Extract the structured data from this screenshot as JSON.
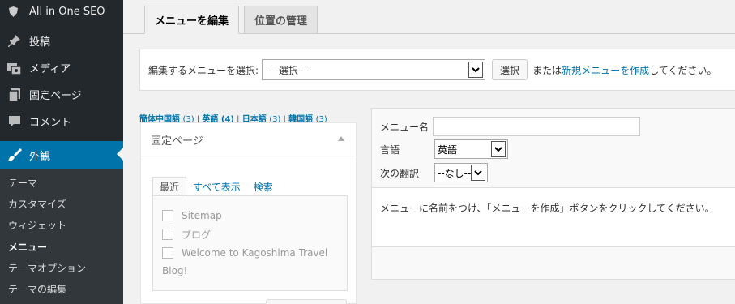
{
  "sidebar": {
    "top_item": "All in One SEO",
    "items": [
      {
        "label": "投稿",
        "icon": "pin-icon"
      },
      {
        "label": "メディア",
        "icon": "media-icon"
      },
      {
        "label": "固定ページ",
        "icon": "pages-icon"
      },
      {
        "label": "コメント",
        "icon": "comment-icon"
      },
      {
        "label": "外観",
        "icon": "appearance-icon"
      }
    ],
    "submenu": [
      "テーマ",
      "カスタマイズ",
      "ウィジェット",
      "メニュー",
      "テーマオプション",
      "テーマの編集"
    ]
  },
  "tabs": [
    "メニューを編集",
    "位置の管理"
  ],
  "select_menu": {
    "label": "編集するメニューを選択:",
    "value": "— 選択 —",
    "button": "選択",
    "or_text": "または",
    "link": "新規メニューを作成",
    "suffix": "してください。"
  },
  "languages": [
    {
      "name": "簡体中国語",
      "count": "(3)",
      "sep": " | "
    },
    {
      "name": "英語",
      "count": "(4)",
      "sep": " | "
    },
    {
      "name": "日本語",
      "count": "(3)",
      "sep": " | "
    },
    {
      "name": "韓国語",
      "count": "(3)",
      "sep": ""
    }
  ],
  "left_box": {
    "title": "固定ページ",
    "tabs": [
      "最近",
      "すべて表示",
      "検索"
    ],
    "items": [
      "Sitemap",
      "ブログ",
      "Welcome to Kagoshima Travel"
    ],
    "overflow_text": "Blog!"
  },
  "right_box": {
    "name_label": "メニュー名",
    "lang_label": "言語",
    "lang_value": "英語",
    "trans_label": "次の翻訳",
    "trans_value": "--なし--",
    "message": "メニューに名前をつけ、「メニューを作成」ボタンをクリックしてください。"
  }
}
